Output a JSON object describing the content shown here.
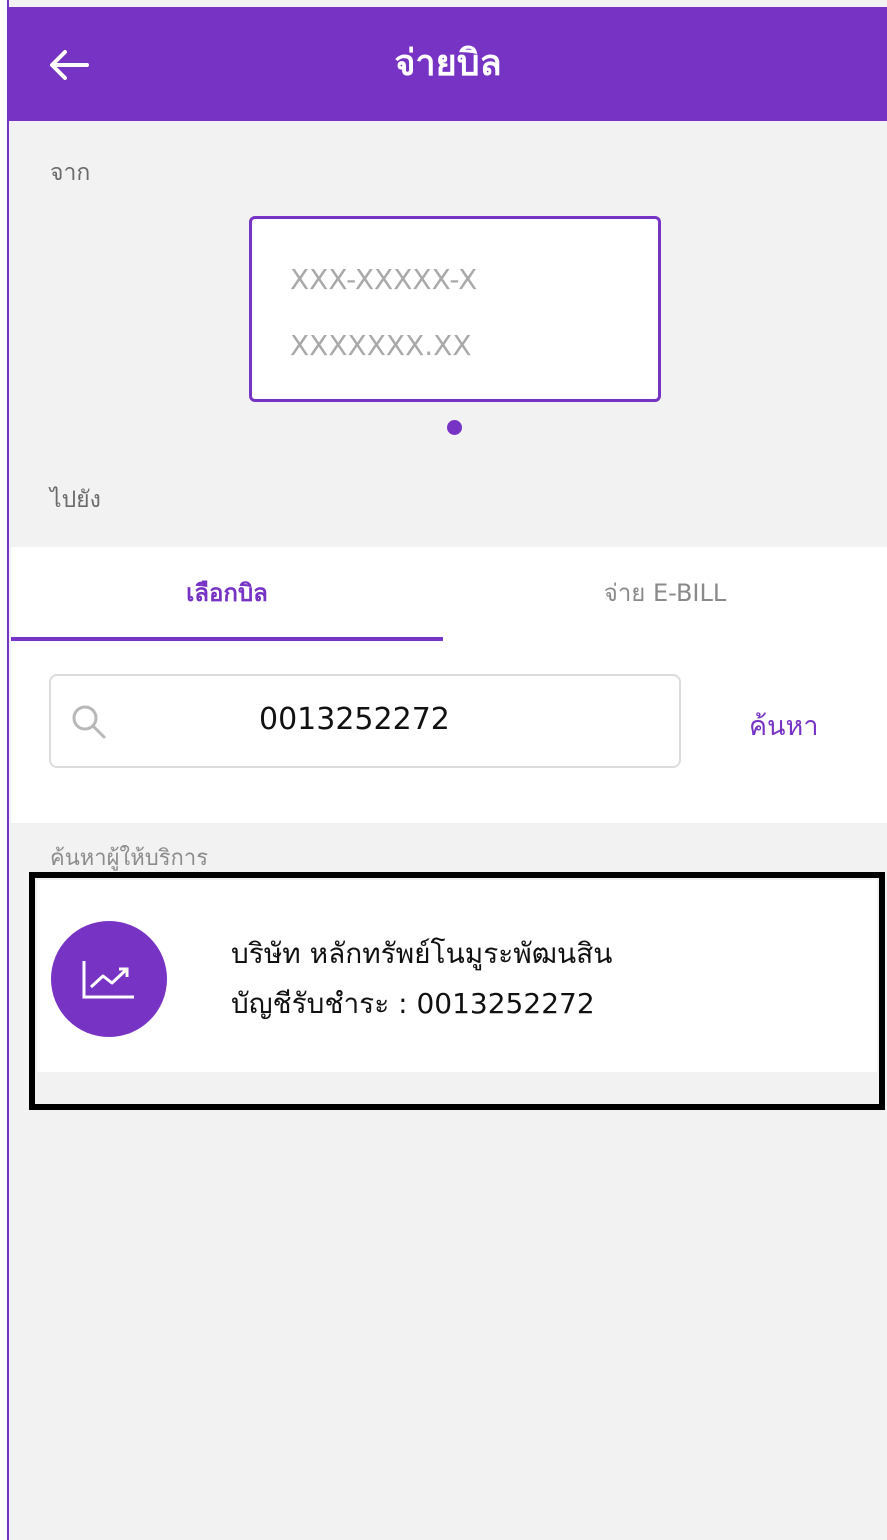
{
  "header": {
    "title": "จ่ายบิล",
    "back_icon": "arrow-left-icon"
  },
  "from": {
    "label": "จาก",
    "account_number": "XXX-XXXXX-X",
    "account_balance": "XXXXXXX.XX"
  },
  "to": {
    "label": "ไปยัง"
  },
  "tabs": [
    {
      "label": "เลือกบิล",
      "active": true
    },
    {
      "label": "จ่าย E-BILL",
      "active": false
    }
  ],
  "search": {
    "icon": "search-icon",
    "value": "0013252272",
    "button_label": "ค้นหา"
  },
  "providers": {
    "section_label": "ค้นหาผู้ให้บริการ",
    "items": [
      {
        "icon": "trending-up-icon",
        "name": "บริษัท หลักทรัพย์โนมูระพัฒนสิน",
        "account_text": "บัญชีรับชำระ : 0013252272"
      }
    ]
  },
  "colors": {
    "accent": "#7733c4",
    "background": "#f2f2f2"
  }
}
